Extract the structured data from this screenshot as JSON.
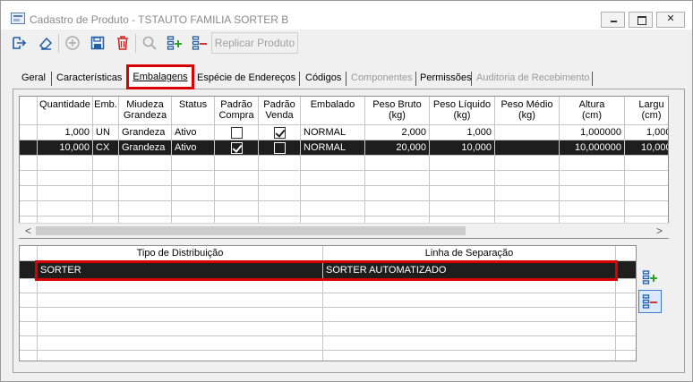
{
  "window": {
    "title": "Cadastro de Produto - TSTAUTO FAMILIA SORTER B",
    "controls": {
      "minimize": "minimize-icon",
      "maximize": "maximize-icon",
      "close": "close-icon"
    }
  },
  "toolbar": {
    "icons": [
      "exit-icon",
      "eraser-icon",
      "add-icon",
      "save-icon",
      "delete-icon",
      "search-icon",
      "add-row-icon",
      "remove-row-icon"
    ],
    "replicar_label": "Replicar Produto"
  },
  "tabs": [
    {
      "label": "Geral",
      "disabled": false
    },
    {
      "label": "Características",
      "disabled": false
    },
    {
      "label": "Embalagens",
      "disabled": false,
      "selected": true
    },
    {
      "label": "Espécie de Endereços",
      "disabled": false
    },
    {
      "label": "Códigos",
      "disabled": false
    },
    {
      "label": "Componentes",
      "disabled": true
    },
    {
      "label": "Permissões",
      "disabled": false
    },
    {
      "label": "Auditoria de Recebimento",
      "disabled": true
    }
  ],
  "packaging_grid": {
    "columns": [
      "Quantidade",
      "Emb.",
      "Miudeza\nGrandeza",
      "Status",
      "Padrão\nCompra",
      "Padrão\nVenda",
      "Embalado",
      "Peso Bruto\n(kg)",
      "Peso Líquido\n(kg)",
      "Peso Médio\n(kg)",
      "Altura\n(cm)",
      "Largu\n(cm)"
    ],
    "rows": [
      {
        "quantidade": "1,000",
        "emb": "UN",
        "miudeza": "Grandeza",
        "status": "Ativo",
        "padrao_compra": false,
        "padrao_venda": true,
        "embalado": "NORMAL",
        "peso_bruto": "2,000",
        "peso_liquido": "1,000",
        "peso_medio": "",
        "altura": "1,000000",
        "largura": "1,000",
        "selected": false
      },
      {
        "quantidade": "10,000",
        "emb": "CX",
        "miudeza": "Grandeza",
        "status": "Ativo",
        "padrao_compra": true,
        "padrao_venda": false,
        "embalado": "NORMAL",
        "peso_bruto": "20,000",
        "peso_liquido": "10,000",
        "peso_medio": "",
        "altura": "10,000000",
        "largura": "10,000",
        "selected": true
      }
    ],
    "scroll_left_arrow": "<",
    "scroll_right_arrow": ">"
  },
  "distribution_grid": {
    "columns": [
      "Tipo de Distribuição",
      "Linha de Separação"
    ],
    "rows": [
      {
        "tipo": "SORTER",
        "linha": "SORTER AUTOMATIZADO",
        "selected": true
      }
    ],
    "side_buttons": [
      "add-row-icon",
      "remove-row-icon"
    ]
  },
  "colors": {
    "highlight_red": "#d90000",
    "selected_row": "#1e1e1e",
    "window_bg": "#f0f0f0"
  }
}
